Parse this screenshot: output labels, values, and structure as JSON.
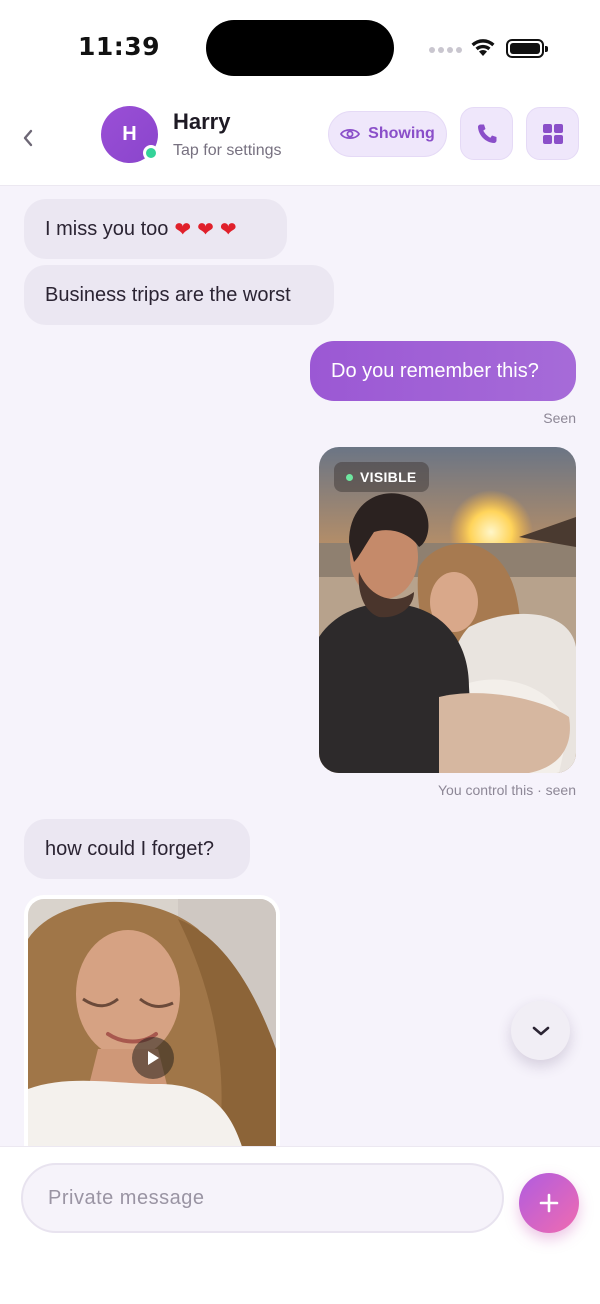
{
  "status_bar": {
    "time": "11:39"
  },
  "header": {
    "avatar_initial": "H",
    "contact_name": "Harry",
    "contact_subtitle": "Tap for settings",
    "visibility_label": "Showing"
  },
  "messages": {
    "m1": {
      "text": "I miss you too",
      "hearts": [
        "❤",
        "❤",
        "❤"
      ]
    },
    "m2": {
      "text": "Business trips are the worst"
    },
    "m3": {
      "text": "Do you remember this?",
      "status": "Seen"
    },
    "m4": {
      "badge": "VISIBLE",
      "caption": "You control this · seen"
    },
    "m5": {
      "text": "how could I forget?"
    }
  },
  "composer": {
    "placeholder": "Private message"
  },
  "colors": {
    "accent": "#9b58d4",
    "online": "#34d399",
    "badge_dot": "#6ee7a0"
  }
}
